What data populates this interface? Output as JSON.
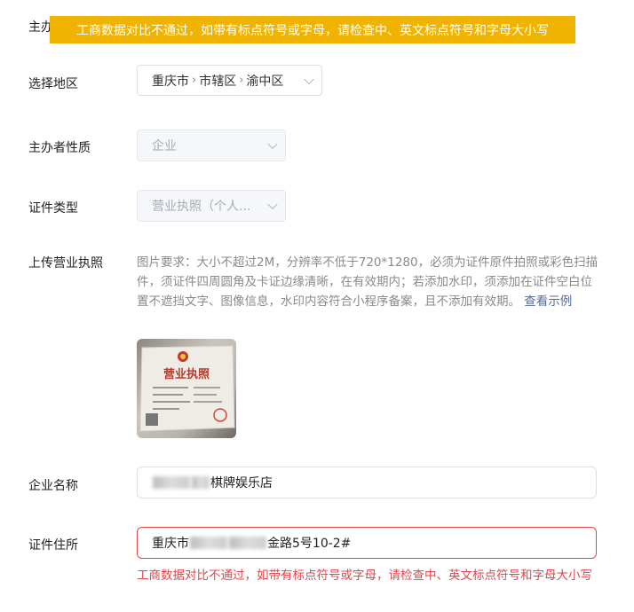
{
  "toast": {
    "message": "工商数据对比不通过，如带有标点符号或字母，请检查中、英文标点符号和字母大小写"
  },
  "top_label_partial": "主办",
  "region": {
    "label": "选择地区",
    "parts": [
      "重庆市",
      "市辖区",
      "渝中区"
    ]
  },
  "org_nature": {
    "label": "主办者性质",
    "value": "企业"
  },
  "cert_type": {
    "label": "证件类型",
    "value": "营业执照（个人..."
  },
  "upload": {
    "label": "上传营业执照",
    "hint": "图片要求：大小不超过2M，分辨率不低于720*1280，必须为证件原件拍照或彩色扫描件，须证件四周圆角及卡证边缘清晰，在有效期内；若添加水印，须添加在证件空白位置不遮挡文字、图像信息，水印内容符合小程序备案，且不添加有效期。",
    "example_link": "查看示例",
    "thumb_title": "营业执照"
  },
  "company_name": {
    "label": "企业名称",
    "value_visible": "棋牌娱乐店"
  },
  "cert_address": {
    "label": "证件住所",
    "value_prefix": "重庆市",
    "value_suffix": "金路5号10-2#",
    "error": "工商数据对比不通过，如带有标点符号或字母，请检查中、英文标点符号和字母大小写"
  },
  "colors": {
    "toast_bg": "#f0b400",
    "error": "#e0464a",
    "link": "#576b95"
  }
}
